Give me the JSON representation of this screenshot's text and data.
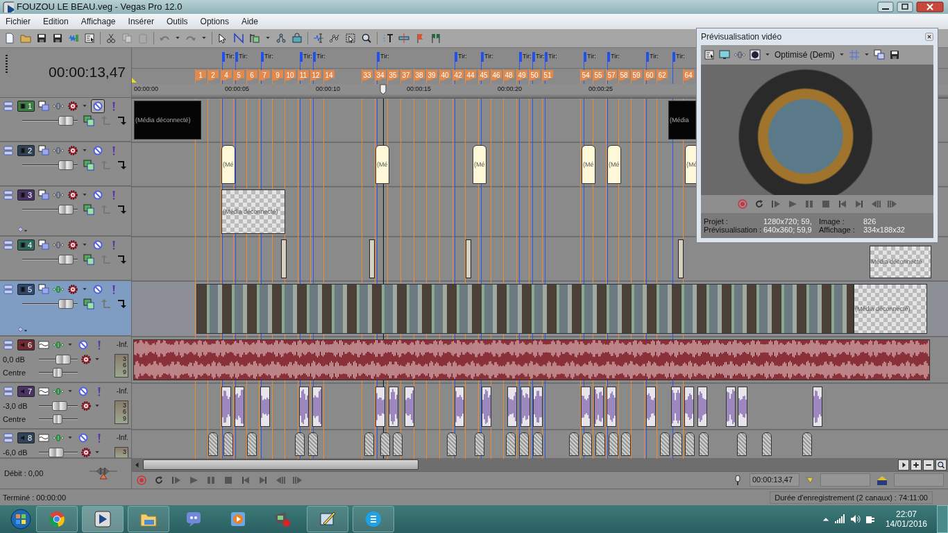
{
  "window": {
    "title": "FOUZOU LE BEAU.veg - Vegas Pro 12.0"
  },
  "menu": [
    "Fichier",
    "Edition",
    "Affichage",
    "Insérer",
    "Outils",
    "Options",
    "Aide"
  ],
  "time_display": "00:00:13,47",
  "regions": [
    {
      "label": "Tir:"
    },
    {
      "label": "Tir:"
    },
    {
      "label": "Tir:"
    },
    {
      "label": "Tir:"
    },
    {
      "label": "Tir:"
    },
    {
      "label": "Tir:"
    },
    {
      "label": "Tir:"
    },
    {
      "label": "Tir:"
    },
    {
      "label": "Tir:"
    },
    {
      "label": "Tir:"
    },
    {
      "label": "Tir:"
    },
    {
      "label": "Tir:"
    },
    {
      "label": "Tir:"
    },
    {
      "label": "Tir:"
    },
    {
      "label": "Tir:"
    }
  ],
  "markers": [
    {
      "label": "1"
    },
    {
      "label": "2"
    },
    {
      "label": "4"
    },
    {
      "label": "5"
    },
    {
      "label": "6"
    },
    {
      "label": "7"
    },
    {
      "label": "9"
    },
    {
      "label": "10"
    },
    {
      "label": "11"
    },
    {
      "label": "12"
    },
    {
      "label": "14"
    },
    {
      "label": "33"
    },
    {
      "label": "34"
    },
    {
      "label": "35"
    },
    {
      "label": "37"
    },
    {
      "label": "38"
    },
    {
      "label": "39"
    },
    {
      "label": "40"
    },
    {
      "label": "42"
    },
    {
      "label": "44"
    },
    {
      "label": "45"
    },
    {
      "label": "46"
    },
    {
      "label": "48"
    },
    {
      "label": "49"
    },
    {
      "label": "50"
    },
    {
      "label": "51"
    },
    {
      "label": "54"
    },
    {
      "label": "55"
    },
    {
      "label": "57"
    },
    {
      "label": "58"
    },
    {
      "label": "59"
    },
    {
      "label": "60"
    },
    {
      "label": "62"
    },
    {
      "label": "64"
    }
  ],
  "ruler": [
    "00:00:00",
    "00:00:05",
    "00:00:10",
    "00:00:15",
    "00:00:20",
    "00:00:25"
  ],
  "tracks": [
    {
      "kind": "video",
      "number": "1",
      "color": "#3f7f47",
      "selected": false,
      "muted": true,
      "opacity": {
        "level": 0.9
      },
      "clips": [
        {
          "label": "(Média déconnecté)"
        },
        {
          "label": "(Média"
        }
      ]
    },
    {
      "kind": "video",
      "number": "2",
      "color": "#2f4257",
      "selected": false,
      "muted": false,
      "opacity": {
        "level": 0.9
      },
      "clips": [
        {
          "label": "(Mé"
        },
        {
          "label": "(Mé"
        },
        {
          "label": "(Mé"
        },
        {
          "label": "(Mé"
        },
        {
          "label": "(Mé"
        },
        {
          "label": "(Mé"
        }
      ]
    },
    {
      "kind": "video",
      "number": "3",
      "color": "#4a3466",
      "selected": false,
      "muted": false,
      "opacity": {
        "level": 0.9
      },
      "clips": [
        {
          "label": "(Média déconnecté)"
        }
      ]
    },
    {
      "kind": "video",
      "number": "4",
      "color": "#2f6a5c",
      "selected": false,
      "muted": false,
      "opacity": {
        "level": 0.9
      },
      "clips": [
        {
          "label": "Média déconnecté"
        }
      ]
    },
    {
      "kind": "video",
      "number": "5",
      "color": "#2f4a6e",
      "selected": true,
      "muted": false,
      "opacity": {
        "level": 0.9
      },
      "clips": [
        {
          "label": "(Média déconnecté)"
        }
      ]
    },
    {
      "kind": "audio",
      "number": "6",
      "color": "#6e2a30",
      "selected": false,
      "muted": false,
      "volume": {
        "label": "0,0 dB",
        "level": 0.7
      },
      "pan": {
        "label": "Centre",
        "level": 0.5
      },
      "peak": "-Inf.",
      "meter_ticks": [
        "3",
        "6",
        "9"
      ]
    },
    {
      "kind": "audio",
      "number": "7",
      "color": "#4a3466",
      "selected": false,
      "muted": false,
      "volume": {
        "label": "-3,0 dB",
        "level": 0.55
      },
      "pan": {
        "label": "Centre",
        "level": 0.5
      },
      "peak": "-Inf.",
      "meter_ticks": [
        "3",
        "6",
        "9"
      ]
    },
    {
      "kind": "audio",
      "number": "8",
      "color": "#2f4257",
      "selected": false,
      "muted": false,
      "volume": {
        "label": "-6,0 dB",
        "level": 0.4
      },
      "peak": "-Inf.",
      "meter_ticks": [
        "3"
      ]
    }
  ],
  "rate": {
    "label": "Débit : 0,00",
    "level": 0.5
  },
  "cursor_time": "00:00:13,47",
  "status": {
    "left": "Terminé : 00:00:00",
    "right": "Durée d'enregistrement (2 canaux) : 74:11:00"
  },
  "preview": {
    "title": "Prévisualisation vidéo",
    "quality": "Optimisé (Demi)",
    "info": [
      {
        "label": "Projet :",
        "value": "1280x720; 59,"
      },
      {
        "label": "Image :",
        "value": "826"
      },
      {
        "label": "Prévisualisation :",
        "value": "640x360; 59,9"
      },
      {
        "label": "Affichage :",
        "value": "334x188x32"
      }
    ]
  },
  "taskbar": {
    "time": "22:07",
    "date": "14/01/2016"
  }
}
